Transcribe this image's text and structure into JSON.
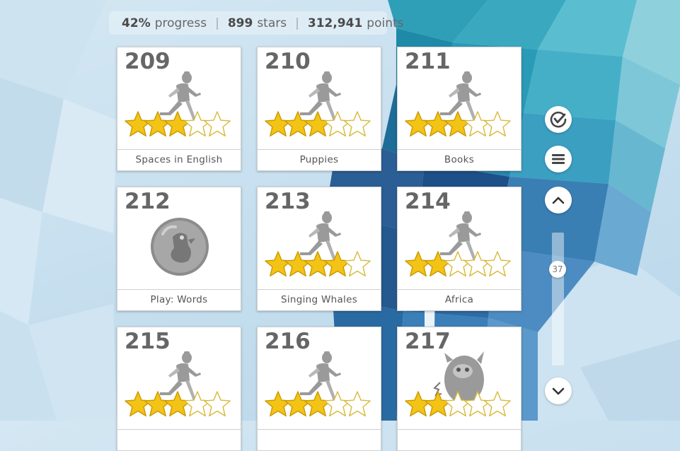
{
  "stats": {
    "progress_value": "42%",
    "progress_label": "progress",
    "stars_value": "899",
    "stars_label": "stars",
    "points_value": "312,941",
    "points_label": "points"
  },
  "levels": [
    {
      "number": "209",
      "title": "Spaces in English",
      "icon": "runner-icon",
      "stars_earned": 3,
      "stars_total": 5
    },
    {
      "number": "210",
      "title": "Puppies",
      "icon": "runner-icon",
      "stars_earned": 3,
      "stars_total": 5
    },
    {
      "number": "211",
      "title": "Books",
      "icon": "runner-icon",
      "stars_earned": 3,
      "stars_total": 5
    },
    {
      "number": "212",
      "title": "Play: Words",
      "icon": "bubble-creature-icon",
      "stars_earned": 0,
      "stars_total": 0
    },
    {
      "number": "213",
      "title": "Singing Whales",
      "icon": "runner-icon",
      "stars_earned": 4,
      "stars_total": 5
    },
    {
      "number": "214",
      "title": "Africa",
      "icon": "runner-icon",
      "stars_earned": 2,
      "stars_total": 5
    },
    {
      "number": "215",
      "title": "",
      "icon": "runner-icon",
      "stars_earned": 3,
      "stars_total": 5
    },
    {
      "number": "216",
      "title": "",
      "icon": "runner-icon",
      "stars_earned": 3,
      "stars_total": 5
    },
    {
      "number": "217",
      "title": "",
      "icon": "monster-icon",
      "stars_earned": 2,
      "stars_total": 5
    }
  ],
  "controls": {
    "check_icon": "check-circle-icon",
    "menu_icon": "menu-icon",
    "up_icon": "chevron-up-icon",
    "down_icon": "chevron-down-icon",
    "scroll_position": "37"
  },
  "colors": {
    "star_fill": "#f3c316",
    "star_empty": "#ffffff",
    "number_text": "#666666",
    "silhouette": "#9a9a9a"
  }
}
